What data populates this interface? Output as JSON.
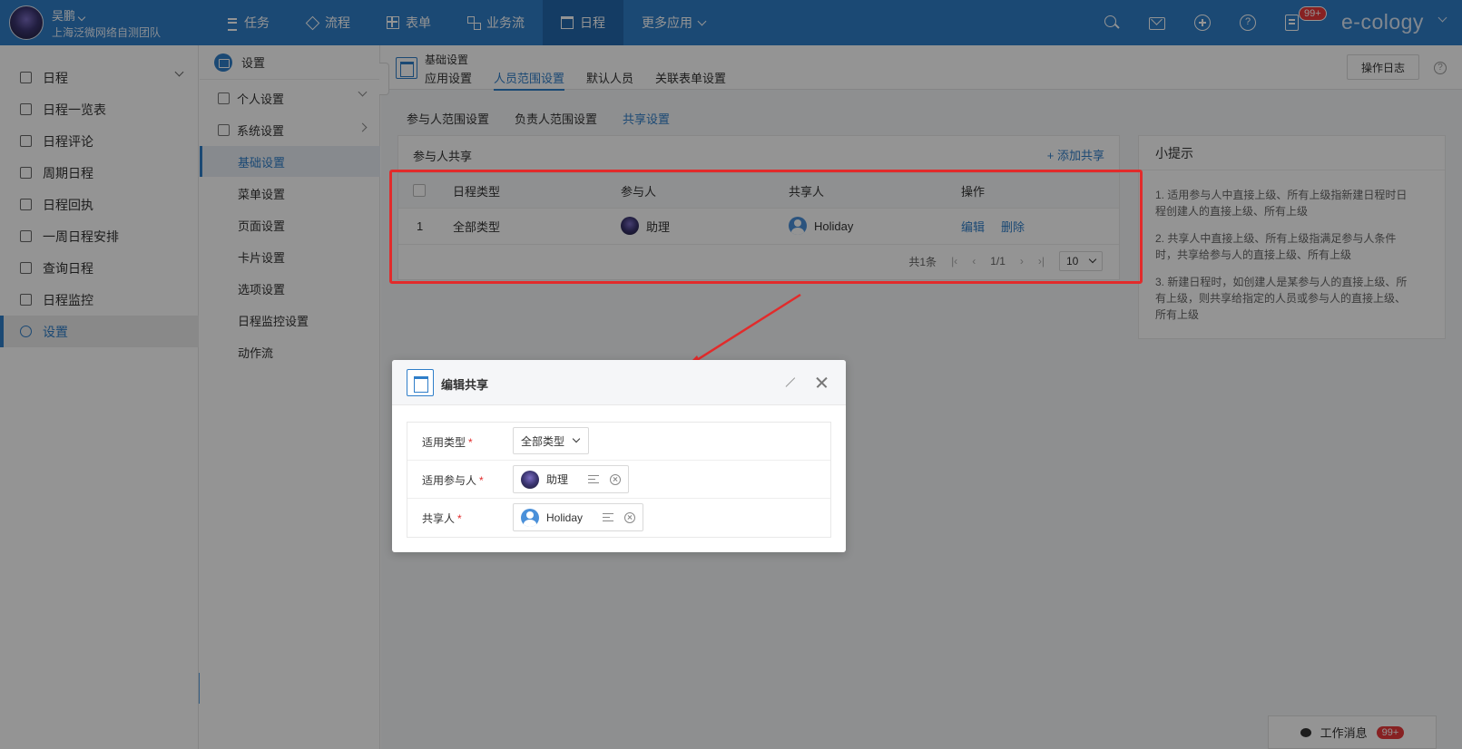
{
  "topbar": {
    "user_name": "吴鹏",
    "user_org": "上海泛微网络自测团队",
    "nav": [
      {
        "label": "任务",
        "icon": "list-icon"
      },
      {
        "label": "流程",
        "icon": "layers-icon"
      },
      {
        "label": "表单",
        "icon": "table-icon"
      },
      {
        "label": "业务流",
        "icon": "apps-icon"
      },
      {
        "label": "日程",
        "icon": "calendar-icon",
        "active": true
      },
      {
        "label": "更多应用",
        "icon": "chevron-down-icon"
      }
    ],
    "notification_badge": "99+",
    "brand": "e-cology",
    "accent_color": "#2f7ec9"
  },
  "sidebar": {
    "items": [
      {
        "label": "日程"
      },
      {
        "label": "日程一览表"
      },
      {
        "label": "日程评论"
      },
      {
        "label": "周期日程"
      },
      {
        "label": "日程回执"
      },
      {
        "label": "一周日程安排"
      },
      {
        "label": "查询日程"
      },
      {
        "label": "日程监控"
      },
      {
        "label": "设置",
        "active": true
      }
    ]
  },
  "subnav": {
    "title": "设置",
    "groups": [
      {
        "label": "个人设置"
      },
      {
        "label": "系统设置"
      }
    ],
    "items": [
      {
        "label": "基础设置",
        "active": true
      },
      {
        "label": "菜单设置"
      },
      {
        "label": "页面设置"
      },
      {
        "label": "卡片设置"
      },
      {
        "label": "选项设置"
      },
      {
        "label": "日程监控设置"
      },
      {
        "label": "动作流"
      }
    ]
  },
  "main": {
    "title": "基础设置",
    "tabs": [
      {
        "label": "应用设置"
      },
      {
        "label": "人员范围设置",
        "active": true
      },
      {
        "label": "默认人员"
      },
      {
        "label": "关联表单设置"
      }
    ],
    "log_button": "操作日志",
    "help": "?",
    "sub_tabs": [
      {
        "label": "参与人范围设置"
      },
      {
        "label": "负责人范围设置"
      },
      {
        "label": "共享设置",
        "active": true
      }
    ],
    "panel": {
      "title": "参与人共享",
      "add_label": "+ 添加共享",
      "columns": [
        "日程类型",
        "参与人",
        "共享人",
        "操作"
      ],
      "rows": [
        {
          "index": "1",
          "type": "全部类型",
          "participant": "助理",
          "sharer": "Holiday",
          "edit": "编辑",
          "delete": "删除"
        }
      ],
      "pager": {
        "total": "共1条",
        "page": "1/1",
        "size": "10"
      }
    },
    "tips": {
      "title": "小提示",
      "items": [
        "1. 适用参与人中直接上级、所有上级指新建日程时日程创建人的直接上级、所有上级",
        "2. 共享人中直接上级、所有上级指满足参与人条件时，共享给参与人的直接上级、所有上级",
        "3. 新建日程时，如创建人是某参与人的直接上级、所有上级，则共享给指定的人员或参与人的直接上级、所有上级"
      ]
    }
  },
  "messages": {
    "label": "工作消息",
    "badge": "99+"
  },
  "modal": {
    "title": "编辑共享",
    "fields": [
      {
        "label": "适用类型",
        "value": "全部类型"
      },
      {
        "label": "适用参与人",
        "value": "助理"
      },
      {
        "label": "共享人",
        "value": "Holiday"
      }
    ]
  }
}
